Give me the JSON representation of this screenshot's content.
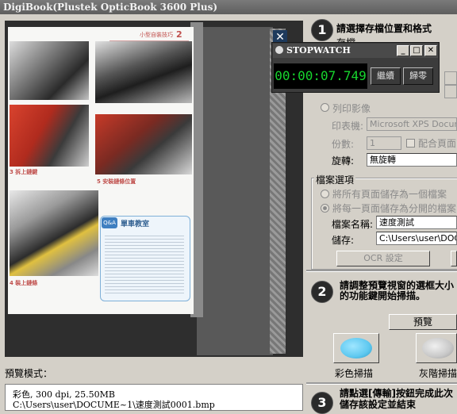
{
  "window": {
    "title": "DigiBook(Plustek OpticBook 3600 Plus)"
  },
  "preview": {
    "mode_label": "預覽模式：",
    "info_line1": "彩色, 300 dpi, 25.50MB",
    "info_line2": "C:\\Users\\user\\DOCUME~1\\速度測試0001.bmp",
    "page_header": "小型自裝技巧",
    "page_number": "2",
    "captions": {
      "cap3": "3 拆上鏈鍵",
      "cap5": "5 安裝鏈條位置",
      "cap4": "4 裝上鏈條"
    },
    "qa": {
      "badge": "Q&A",
      "title": "單車教室"
    }
  },
  "stopwatch": {
    "title": "STOPWATCH",
    "time": "00:00:07.749",
    "continue_label": "繼續",
    "reset_label": "歸零",
    "min_glyph": "_",
    "max_glyph": "□",
    "close_glyph": "✕"
  },
  "step1": {
    "number": "1",
    "title": "請選擇存檔位置和格式",
    "subtitle_partial": "存檔",
    "print_radio_label": "列印影像",
    "printer_label": "印表機:",
    "printer_value": "Microsoft XPS Docume",
    "copies_label": "份數:",
    "copies_value": "1",
    "fit_page_label": "配合頁面",
    "rotate_label": "旋轉:",
    "rotate_value": "無旋轉",
    "file_options_label": "檔案選項",
    "radio_all_one": "將所有頁面儲存為一個檔案",
    "radio_each_sep": "將每一頁面儲存為分開的檔案",
    "filename_label": "檔案名稱:",
    "filename_value": "速度測試",
    "save_label": "儲存:",
    "save_value": "C:\\Users\\user\\DOCUI",
    "ocr_button": "OCR 設定"
  },
  "step2": {
    "number": "2",
    "title_line1": "請調整預覽視窗的選框大小",
    "title_line2": "的功能鍵開始掃描。",
    "preview_button": "預覽",
    "color_scan_label": "彩色掃描",
    "gray_scan_label": "灰階掃描",
    "accent_color": "#5ec8f0"
  },
  "step3": {
    "number": "3",
    "title_line1": "請點選[傳輸]按鈕完成此次",
    "title_line2": "儲存該設定並結束"
  }
}
